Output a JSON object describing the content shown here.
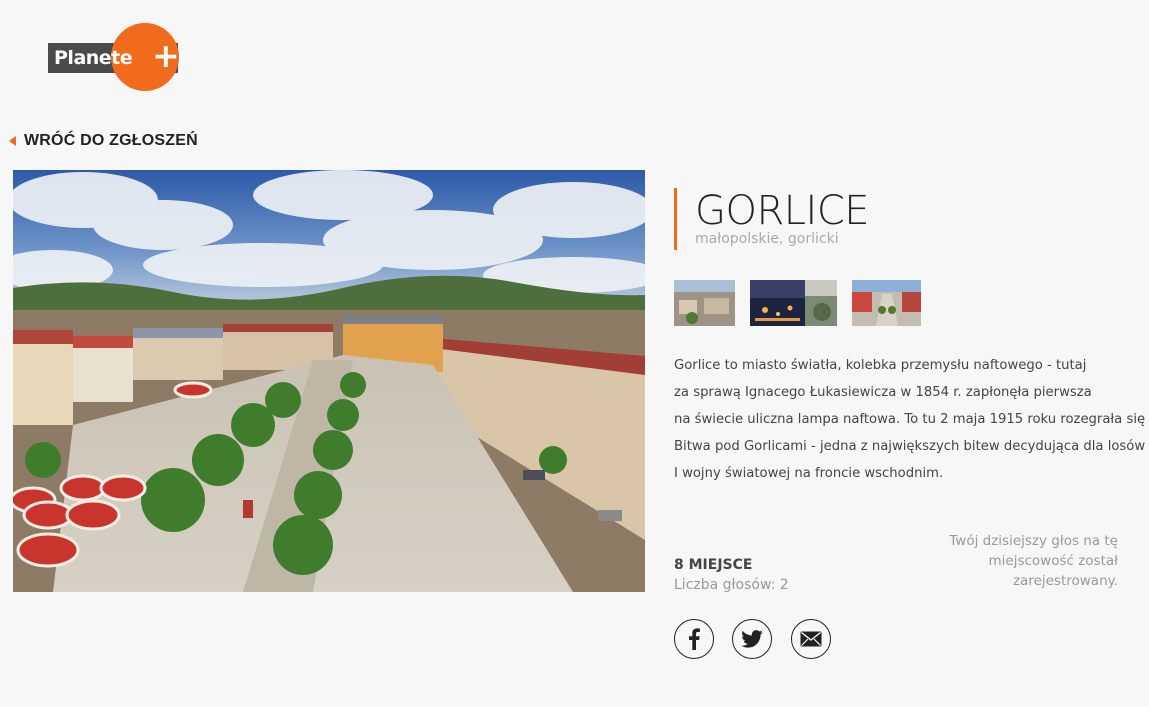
{
  "brand": {
    "name": "Planete",
    "plus": "+",
    "colors": {
      "orange": "#f26b1d",
      "dark": "#4a4a4a"
    }
  },
  "nav": {
    "back_label": "WRÓĆ DO ZGŁOSZEŃ"
  },
  "place": {
    "name": "GORLICE",
    "region": "małopolskie, gorlicki",
    "description_lines": [
      "Gorlice to miasto światła, kolebka przemysłu naftowego - tutaj",
      "za sprawą Ignacego Łukasiewicza w 1854 r. zapłonęła pierwsza",
      "na świecie uliczna lampa naftowa. To tu 2 maja 1915 roku rozegrała się",
      "Bitwa pod Gorlicami - jedna z największych bitew decydująca dla losów",
      "I wojny światowej na froncie wschodnim."
    ]
  },
  "ranking": {
    "position": "8 MIEJSCE",
    "votes": "Liczba głosów: 2"
  },
  "notice": {
    "lines": [
      "Twój dzisiejszy głos na tę",
      "miejscowość został",
      "zarejestrowany."
    ]
  },
  "social": {
    "icons": [
      "facebook-icon",
      "twitter-icon",
      "email-icon"
    ]
  }
}
